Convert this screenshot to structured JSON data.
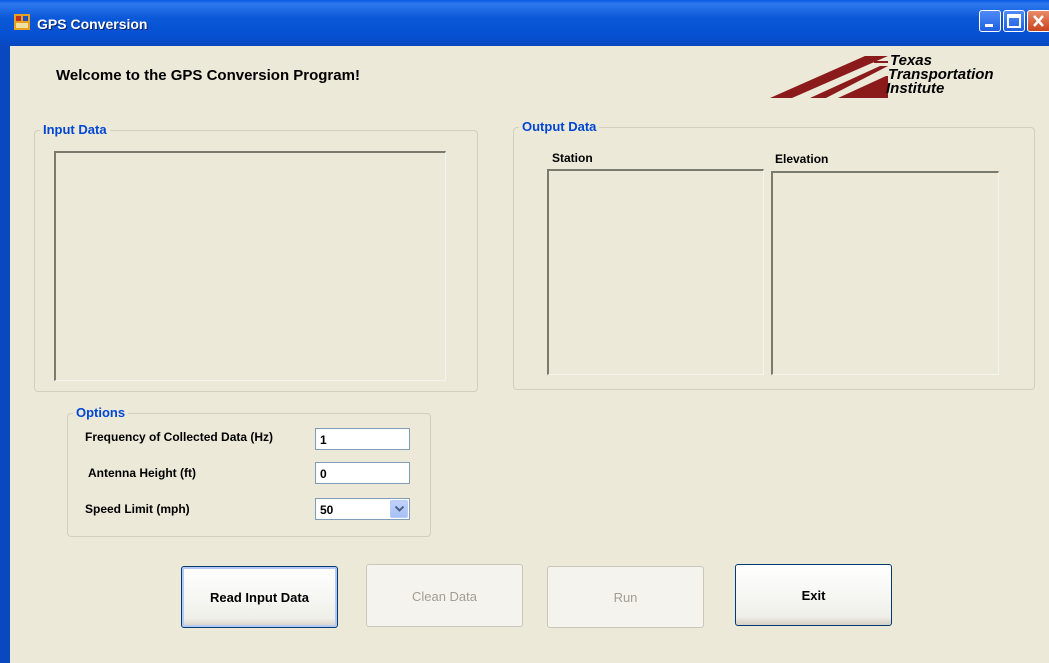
{
  "window": {
    "title": "GPS Conversion"
  },
  "header": {
    "welcome": "Welcome to the GPS Conversion Program!"
  },
  "logo": {
    "line1": "Texas",
    "line2": "Transportation",
    "line3": "Institute",
    "color": "#8B1A1A"
  },
  "input_group": {
    "label": "Input Data"
  },
  "output_group": {
    "label": "Output Data",
    "station_label": "Station",
    "elevation_label": "Elevation"
  },
  "options": {
    "label": "Options",
    "frequency_label": "Frequency of Collected Data (Hz)",
    "frequency_value": "1",
    "antenna_label": "Antenna Height (ft)",
    "antenna_value": "0",
    "speed_label": "Speed Limit (mph)",
    "speed_value": "50"
  },
  "buttons": {
    "read": "Read Input Data",
    "clean": "Clean Data",
    "run": "Run",
    "exit": "Exit"
  },
  "colors": {
    "titlebar": "#0A58D8",
    "group_label": "#0046D5",
    "background": "#ECE9D8"
  }
}
